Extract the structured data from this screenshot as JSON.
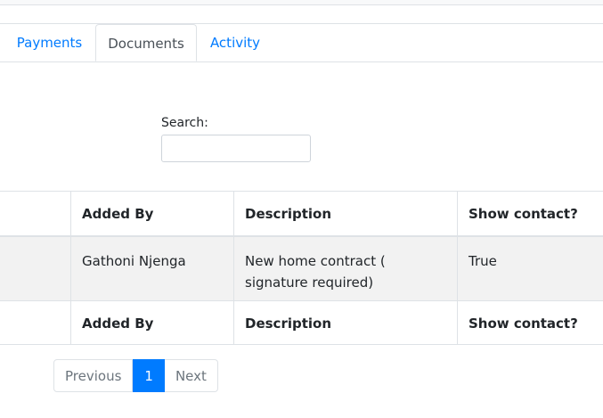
{
  "tabs": [
    {
      "label": "Payments",
      "active": false
    },
    {
      "label": "Documents",
      "active": true
    },
    {
      "label": "Activity",
      "active": false
    }
  ],
  "search": {
    "label": "Search:",
    "value": "",
    "placeholder": ""
  },
  "table": {
    "columns": [
      "",
      "Added By",
      "Description",
      "Show contact?"
    ],
    "rows": [
      {
        "col0": "",
        "added_by": "Gathoni Njenga",
        "description": "New home contract ( signature required)",
        "show_contact": "True"
      }
    ],
    "footer_columns": [
      "",
      "Added By",
      "Description",
      "Show contact?"
    ]
  },
  "pagination": {
    "previous": "Previous",
    "current": "1",
    "next": "Next"
  },
  "colors": {
    "accent": "#007bff",
    "border": "#dee2e6",
    "striped_row": "#f2f2f2"
  }
}
